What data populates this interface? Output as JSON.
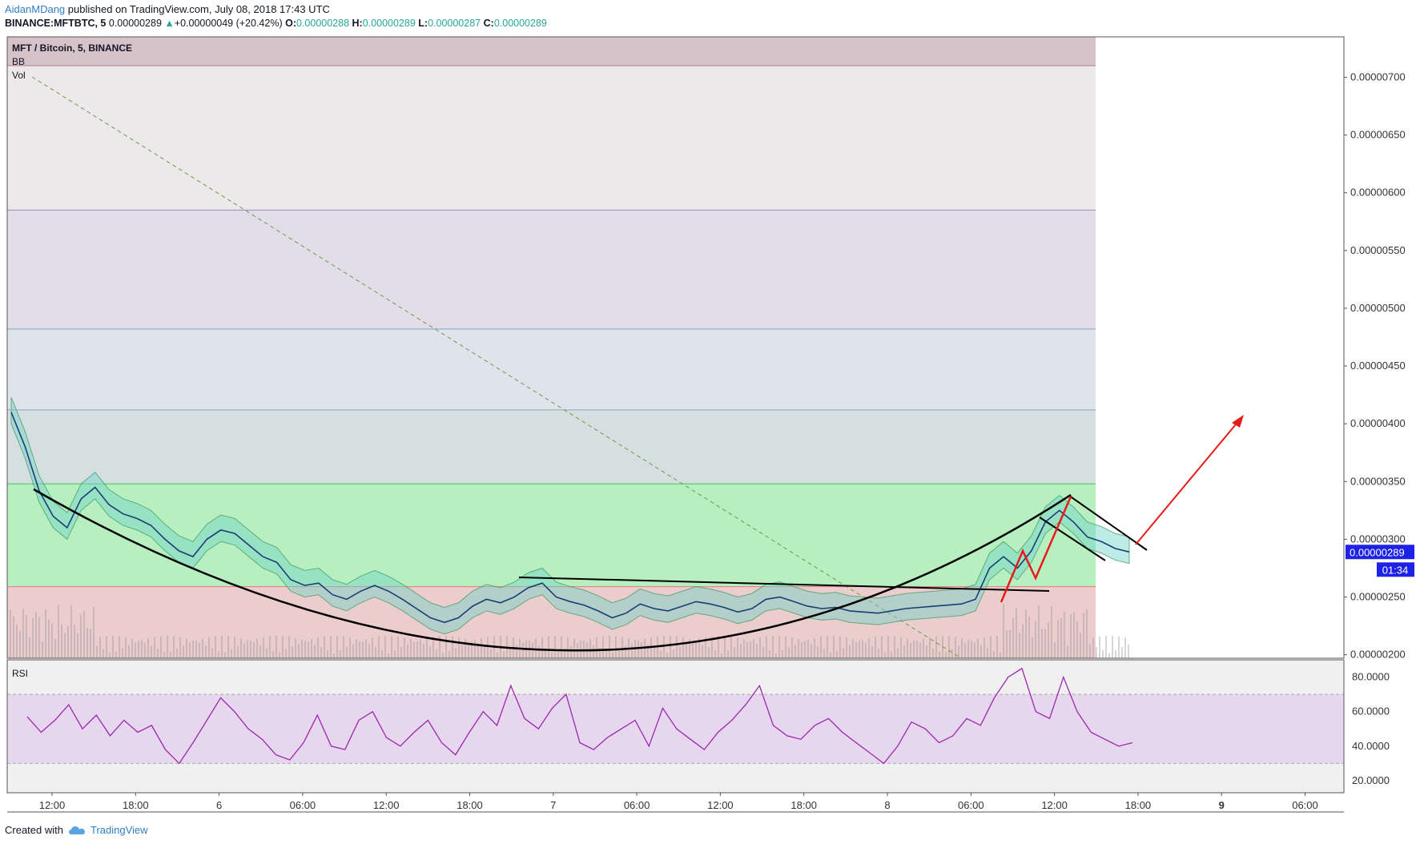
{
  "header": {
    "author": "AidanMDang",
    "published": " published on TradingView.com, July 08, 2018 17:43 UTC"
  },
  "quote": {
    "symbol": "BINANCE:MFTBTC, 5",
    "last": "0.00000289",
    "arrow": "▲",
    "change": "+0.00000049 (+20.42%)",
    "o_label": "O:",
    "o": "0.00000288",
    "h_label": "H:",
    "h": "0.00000289",
    "l_label": "L:",
    "l": "0.00000287",
    "c_label": "C:",
    "c": "0.00000289"
  },
  "legend": {
    "pair": "MFT / Bitcoin, 5, BINANCE",
    "bb": "BB",
    "vol": "Vol",
    "rsi": "RSI"
  },
  "price_tag": {
    "value": "0.00000289",
    "countdown": "01:34"
  },
  "footer": {
    "created": "Created with",
    "brand": "TradingView"
  },
  "colors": {
    "up": "#26a69a",
    "price_tag": "#1e22e6",
    "rsi_line": "#9c27b0",
    "arrow": "#e81b1b",
    "cup_line": "#000000"
  },
  "chart_data": {
    "type": "line",
    "price_axis": {
      "ticks": [
        "0.00000700",
        "0.00000650",
        "0.00000600",
        "0.00000550",
        "0.00000500",
        "0.00000450",
        "0.00000400",
        "0.00000350",
        "0.00000300",
        "0.00000250",
        "0.00000200"
      ],
      "ylim": [
        1.97e-06,
        7.35e-06
      ]
    },
    "rsi_axis": {
      "ticks": [
        "80.0000",
        "60.0000",
        "40.0000",
        "20.0000"
      ],
      "ylim": [
        13,
        90
      ],
      "bands": [
        30,
        70
      ]
    },
    "x_ticks": [
      "12:00",
      "18:00",
      "6",
      "06:00",
      "12:00",
      "18:00",
      "7",
      "06:00",
      "12:00",
      "18:00",
      "8",
      "06:00",
      "12:00",
      "18:00",
      "9",
      "06:00"
    ],
    "fib_levels": [
      7.1e-06,
      5.85e-06,
      4.82e-06,
      4.12e-06,
      3.48e-06,
      2.59e-06,
      1.97e-06
    ],
    "price_series": [
      [
        0,
        4.1e-06
      ],
      [
        1,
        3.8e-06
      ],
      [
        2,
        3.42e-06
      ],
      [
        3,
        3.2e-06
      ],
      [
        4,
        3.1e-06
      ],
      [
        5,
        3.35e-06
      ],
      [
        6,
        3.45e-06
      ],
      [
        7,
        3.3e-06
      ],
      [
        8,
        3.22e-06
      ],
      [
        9,
        3.18e-06
      ],
      [
        10,
        3.12e-06
      ],
      [
        11,
        3e-06
      ],
      [
        12,
        2.9e-06
      ],
      [
        13,
        2.85e-06
      ],
      [
        14,
        3e-06
      ],
      [
        15,
        3.08e-06
      ],
      [
        16,
        3.05e-06
      ],
      [
        17,
        2.95e-06
      ],
      [
        18,
        2.85e-06
      ],
      [
        19,
        2.8e-06
      ],
      [
        20,
        2.65e-06
      ],
      [
        21,
        2.6e-06
      ],
      [
        22,
        2.62e-06
      ],
      [
        23,
        2.52e-06
      ],
      [
        24,
        2.48e-06
      ],
      [
        25,
        2.55e-06
      ],
      [
        26,
        2.6e-06
      ],
      [
        27,
        2.55e-06
      ],
      [
        28,
        2.48e-06
      ],
      [
        29,
        2.4e-06
      ],
      [
        30,
        2.32e-06
      ],
      [
        31,
        2.28e-06
      ],
      [
        32,
        2.32e-06
      ],
      [
        33,
        2.42e-06
      ],
      [
        34,
        2.48e-06
      ],
      [
        35,
        2.45e-06
      ],
      [
        36,
        2.5e-06
      ],
      [
        37,
        2.58e-06
      ],
      [
        38,
        2.62e-06
      ],
      [
        39,
        2.5e-06
      ],
      [
        40,
        2.46e-06
      ],
      [
        41,
        2.43e-06
      ],
      [
        42,
        2.38e-06
      ],
      [
        43,
        2.32e-06
      ],
      [
        44,
        2.36e-06
      ],
      [
        45,
        2.44e-06
      ],
      [
        46,
        2.4e-06
      ],
      [
        47,
        2.38e-06
      ],
      [
        48,
        2.42e-06
      ],
      [
        49,
        2.46e-06
      ],
      [
        50,
        2.44e-06
      ],
      [
        51,
        2.41e-06
      ],
      [
        52,
        2.37e-06
      ],
      [
        53,
        2.4e-06
      ],
      [
        54,
        2.48e-06
      ],
      [
        55,
        2.5e-06
      ],
      [
        56,
        2.46e-06
      ],
      [
        57,
        2.42e-06
      ],
      [
        58,
        2.4e-06
      ],
      [
        59,
        2.41e-06
      ],
      [
        60,
        2.38e-06
      ],
      [
        61,
        2.37e-06
      ],
      [
        62,
        2.36e-06
      ],
      [
        63,
        2.38e-06
      ],
      [
        64,
        2.4e-06
      ],
      [
        65,
        2.41e-06
      ],
      [
        66,
        2.42e-06
      ],
      [
        67,
        2.43e-06
      ],
      [
        68,
        2.44e-06
      ],
      [
        69,
        2.48e-06
      ],
      [
        70,
        2.75e-06
      ],
      [
        71,
        2.85e-06
      ],
      [
        72,
        2.75e-06
      ],
      [
        73,
        2.9e-06
      ],
      [
        74,
        3.15e-06
      ],
      [
        75,
        3.25e-06
      ],
      [
        76,
        3.15e-06
      ],
      [
        77,
        3.02e-06
      ],
      [
        78,
        2.98e-06
      ],
      [
        79,
        2.92e-06
      ],
      [
        80,
        2.89e-06
      ]
    ],
    "rsi_series": [
      [
        0,
        57
      ],
      [
        1,
        48
      ],
      [
        2,
        55
      ],
      [
        3,
        64
      ],
      [
        4,
        50
      ],
      [
        5,
        58
      ],
      [
        6,
        46
      ],
      [
        7,
        55
      ],
      [
        8,
        48
      ],
      [
        9,
        52
      ],
      [
        10,
        38
      ],
      [
        11,
        30
      ],
      [
        12,
        42
      ],
      [
        13,
        55
      ],
      [
        14,
        68
      ],
      [
        15,
        60
      ],
      [
        16,
        50
      ],
      [
        17,
        44
      ],
      [
        18,
        35
      ],
      [
        19,
        32
      ],
      [
        20,
        42
      ],
      [
        21,
        58
      ],
      [
        22,
        40
      ],
      [
        23,
        38
      ],
      [
        24,
        55
      ],
      [
        25,
        60
      ],
      [
        26,
        45
      ],
      [
        27,
        40
      ],
      [
        28,
        48
      ],
      [
        29,
        55
      ],
      [
        30,
        42
      ],
      [
        31,
        35
      ],
      [
        32,
        48
      ],
      [
        33,
        60
      ],
      [
        34,
        52
      ],
      [
        35,
        75
      ],
      [
        36,
        56
      ],
      [
        37,
        50
      ],
      [
        38,
        62
      ],
      [
        39,
        70
      ],
      [
        40,
        42
      ],
      [
        41,
        38
      ],
      [
        42,
        45
      ],
      [
        43,
        50
      ],
      [
        44,
        55
      ],
      [
        45,
        40
      ],
      [
        46,
        62
      ],
      [
        47,
        50
      ],
      [
        48,
        44
      ],
      [
        49,
        38
      ],
      [
        50,
        48
      ],
      [
        51,
        55
      ],
      [
        52,
        64
      ],
      [
        53,
        75
      ],
      [
        54,
        52
      ],
      [
        55,
        46
      ],
      [
        56,
        44
      ],
      [
        57,
        52
      ],
      [
        58,
        56
      ],
      [
        59,
        48
      ],
      [
        60,
        42
      ],
      [
        61,
        36
      ],
      [
        62,
        30
      ],
      [
        63,
        40
      ],
      [
        64,
        54
      ],
      [
        65,
        50
      ],
      [
        66,
        42
      ],
      [
        67,
        46
      ],
      [
        68,
        56
      ],
      [
        69,
        52
      ],
      [
        70,
        68
      ],
      [
        71,
        80
      ],
      [
        72,
        85
      ],
      [
        73,
        60
      ],
      [
        74,
        56
      ],
      [
        75,
        80
      ],
      [
        76,
        60
      ],
      [
        77,
        48
      ],
      [
        78,
        44
      ],
      [
        79,
        40
      ],
      [
        80,
        42
      ]
    ]
  }
}
